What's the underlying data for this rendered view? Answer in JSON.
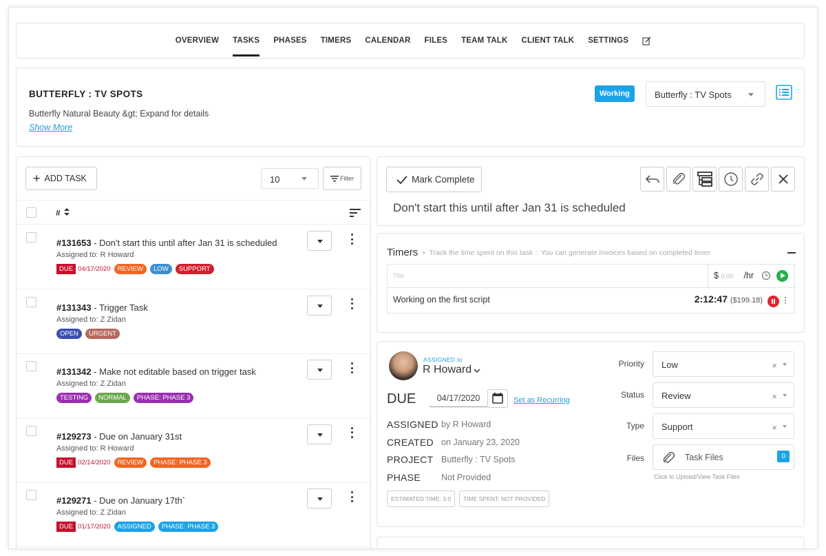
{
  "nav": {
    "tabs": [
      "OVERVIEW",
      "TASKS",
      "PHASES",
      "TIMERS",
      "CALENDAR",
      "FILES",
      "TEAM TALK",
      "CLIENT TALK",
      "SETTINGS"
    ],
    "active": "TASKS",
    "edit_icon": "edit-icon"
  },
  "project": {
    "title": "BUTTERFLY : TV SPOTS",
    "description": "Butterfly Natural Beauty &gt; Expand for details",
    "show_more": "Show More",
    "status_badge": "Working",
    "selector_value": "Butterfly : TV Spots",
    "colors": {
      "accent": "#1aa3e8",
      "link": "#1e9fd9"
    }
  },
  "task_list": {
    "add_label": "ADD TASK",
    "per_page": "10",
    "filter_label": "Filter",
    "hash_header": "#",
    "assigned_prefix": "Assigned to:",
    "tasks": [
      {
        "id": "#131653",
        "title": " - Don't start this until after Jan 31 is scheduled",
        "assigned": "Assigned to: R Howard",
        "due": "04/17/2020",
        "tags": [
          {
            "label": "REVIEW",
            "color": "#f26522"
          },
          {
            "label": "LOW",
            "color": "#3d8fcf"
          },
          {
            "label": "SUPPORT",
            "color": "#d01f2e"
          }
        ]
      },
      {
        "id": "#131343",
        "title": " - Trigger Task",
        "assigned": "Assigned to: Z Zidan",
        "due": "",
        "tags": [
          {
            "label": "OPEN",
            "color": "#3b4fae"
          },
          {
            "label": "URGENT",
            "color": "#b46b5e"
          }
        ]
      },
      {
        "id": "#131342",
        "title": " - Make not editable based on trigger task",
        "assigned": "Assigned to: Z Zidan",
        "due": "",
        "tags": [
          {
            "label": "TESTING",
            "color": "#9a2fb0"
          },
          {
            "label": "NORMAL",
            "color": "#6aa84f"
          },
          {
            "label": "PHASE: PHASE 3",
            "color": "#9a2fb0"
          }
        ]
      },
      {
        "id": "#129273",
        "title": " - Due on January 31st",
        "assigned": "Assigned to: R Howard",
        "due": "02/14/2020",
        "tags": [
          {
            "label": "REVIEW",
            "color": "#f26522"
          },
          {
            "label": "PHASE: PHASE 3",
            "color": "#f26522"
          }
        ]
      },
      {
        "id": "#129271",
        "title": " - Due on January 17th`",
        "assigned": "Assigned to: Z Zidan",
        "due": "01/17/2020",
        "tags": [
          {
            "label": "ASSIGNED",
            "color": "#1aa3e8"
          },
          {
            "label": "PHASE: PHASE 3",
            "color": "#1aa3e8"
          }
        ]
      }
    ],
    "due_label": "DUE"
  },
  "detail": {
    "mark_complete": "Mark Complete",
    "title": "Don't start this until after Jan 31 is scheduled",
    "toolbar_icons": [
      "undo-icon",
      "attach-icon",
      "subtasks-icon",
      "timer-icon",
      "link-icon",
      "close-icon"
    ]
  },
  "timers": {
    "heading": "Timers",
    "subtitle": "Track the time spent on this task :: You can generate invoices based on completed timer",
    "title_placeholder": "Title",
    "currency": "$",
    "rate_placeholder": "0.00",
    "per_hour": "/hr",
    "entry_label": "Working on the first script",
    "entry_time": "2:12:47",
    "entry_amount": "($199.18)"
  },
  "info": {
    "assigned_small": "ASSIGNED to",
    "assignee": "R Howard",
    "due_label": "DUE",
    "due_date": "04/17/2020",
    "recurring": "Set as Recurring",
    "meta": [
      {
        "label": "ASSIGNED",
        "value": "by R Howard"
      },
      {
        "label": "CREATED",
        "value": "on January 23, 2020"
      },
      {
        "label": "PROJECT",
        "value": "Butterfly : TV Spots"
      },
      {
        "label": "PHASE",
        "value": "Not Provided"
      }
    ],
    "estimated": "ESTIMATED TIME: 3.0",
    "spent": "TIME SPENT: NOT PROVIDED",
    "props": [
      {
        "label": "Priority",
        "value": "Low"
      },
      {
        "label": "Status",
        "value": "Review"
      },
      {
        "label": "Type",
        "value": "Support"
      }
    ],
    "files_label": "Files",
    "files_btn": "Task Files",
    "files_count": "0",
    "files_hint": "Click to Upload/View Task Files",
    "clear_glyph": "×"
  }
}
